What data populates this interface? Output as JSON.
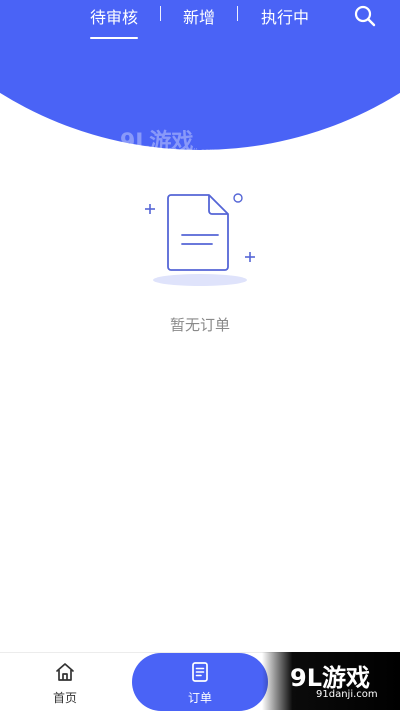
{
  "header": {
    "tabs": [
      {
        "label": "待审核",
        "active": true
      },
      {
        "label": "新增",
        "active": false
      },
      {
        "label": "执行中",
        "active": false
      }
    ],
    "separator": "|",
    "search_icon": "search-icon",
    "accent_color": "#4a63f6"
  },
  "empty_state": {
    "icon": "document-icon",
    "text": "暂无订单"
  },
  "bottom_nav": {
    "items": [
      {
        "label": "首页",
        "icon": "home-icon",
        "active": false
      },
      {
        "label": "订单",
        "icon": "order-list-icon",
        "active": true
      }
    ]
  },
  "watermark": {
    "brand": "9L游戏",
    "domain": "91danji.com"
  }
}
